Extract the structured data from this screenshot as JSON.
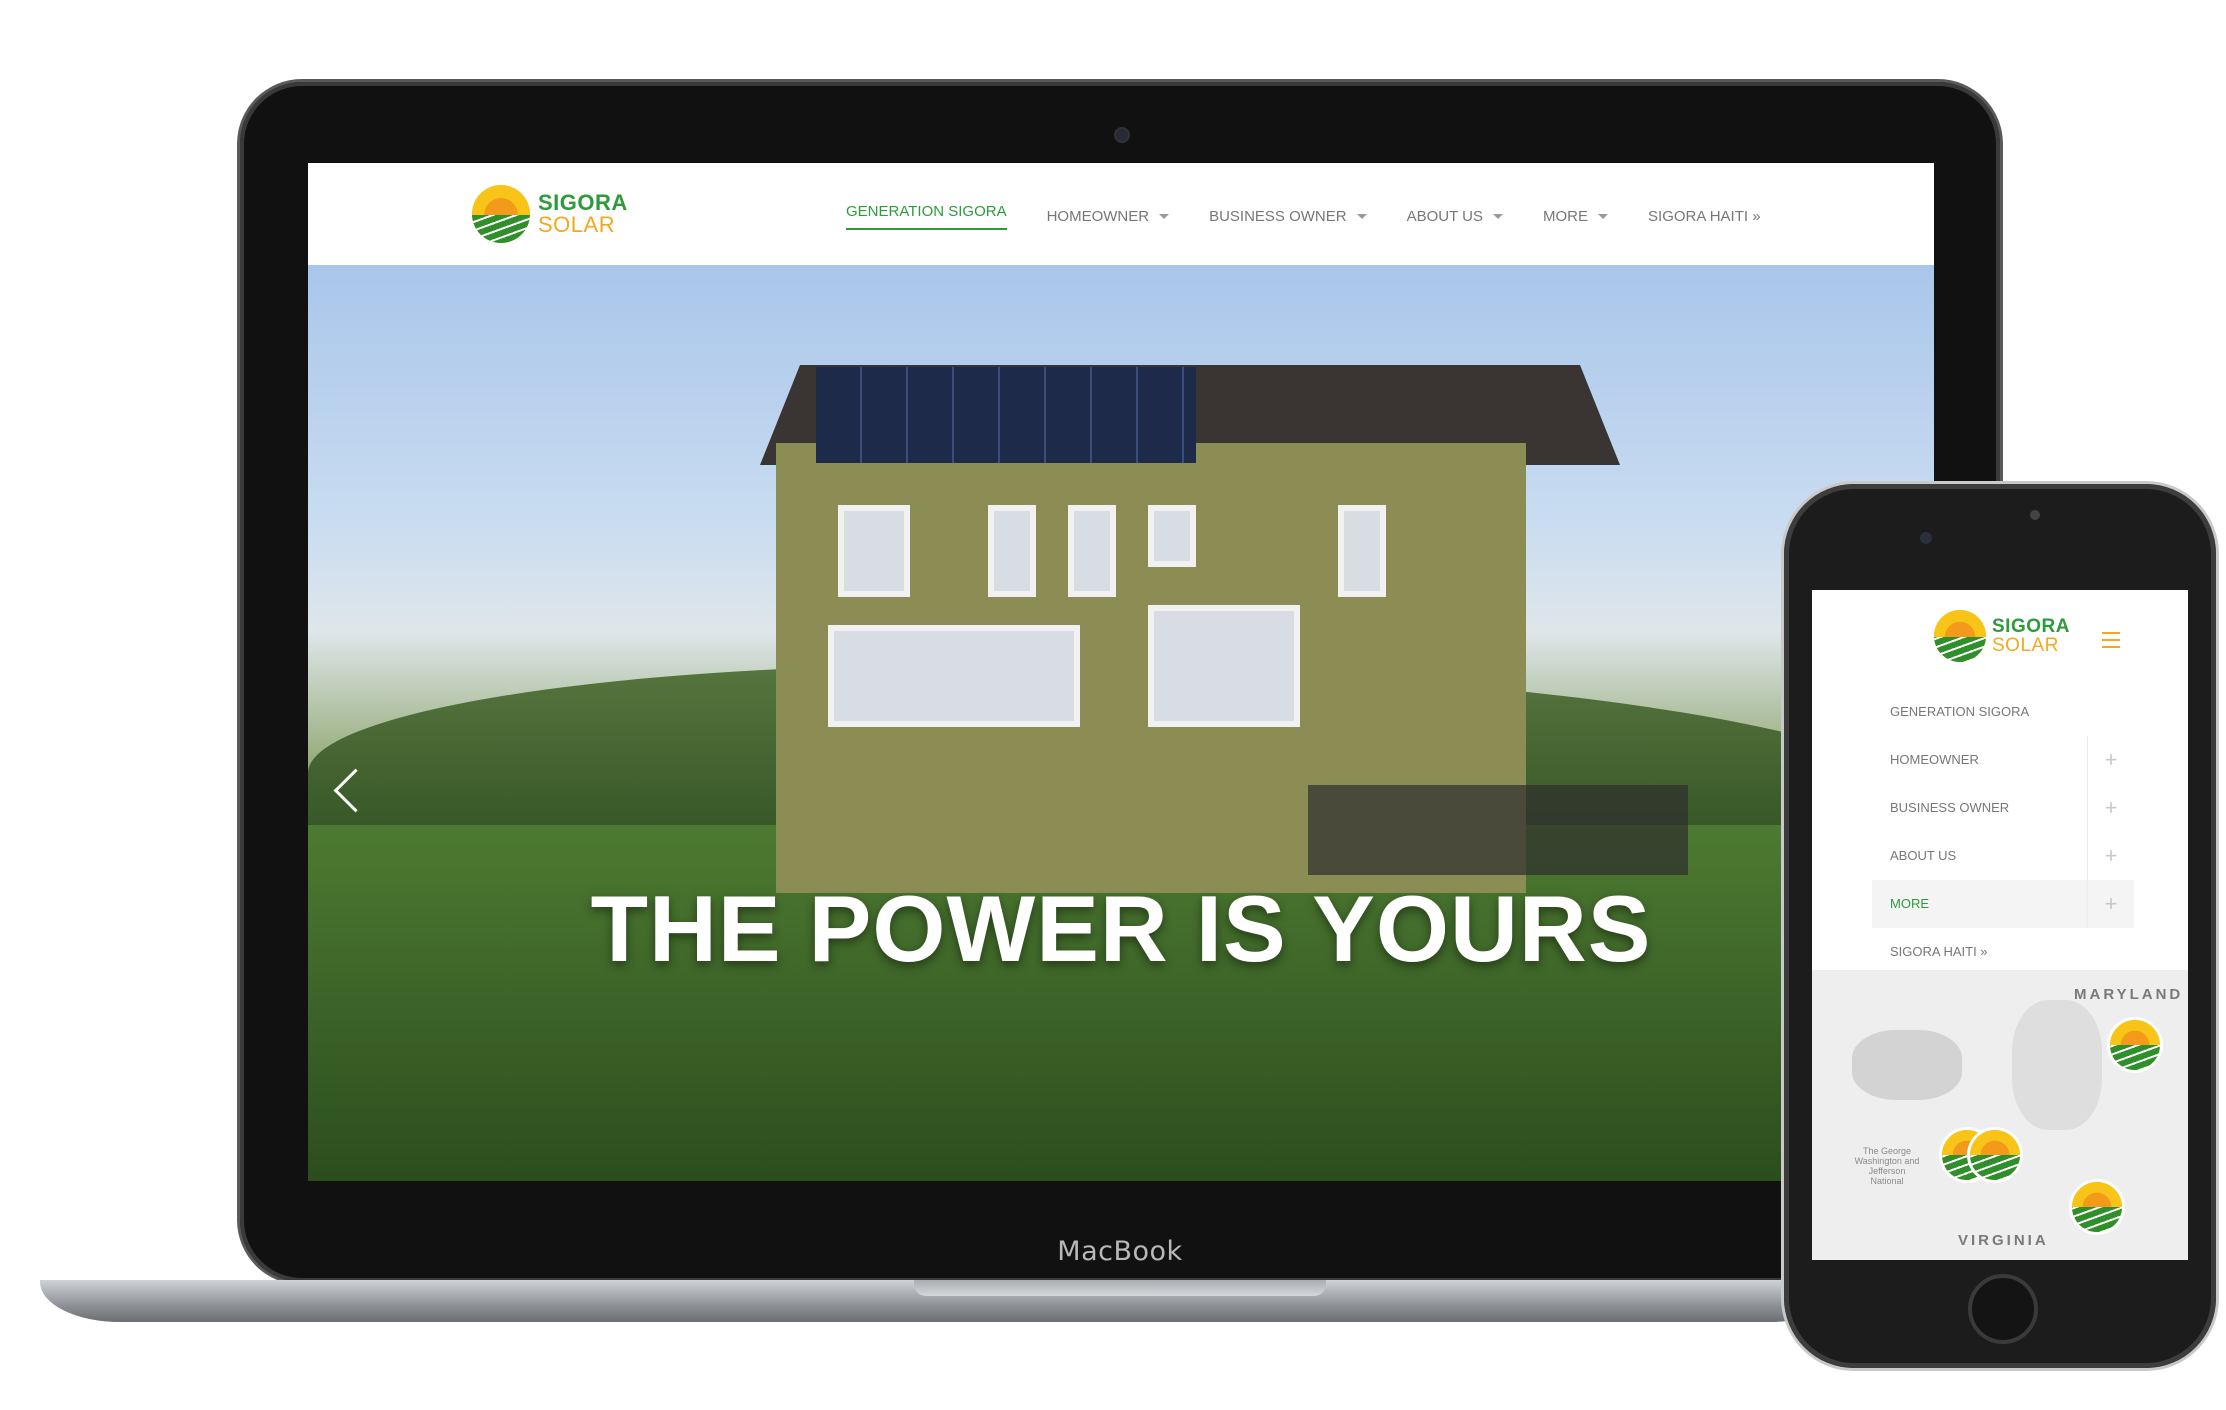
{
  "site": {
    "logo": {
      "line1": "SIGORA",
      "line2": "SOLAR"
    },
    "nav": [
      {
        "label": "GENERATION SIGORA",
        "dropdown": false,
        "active": true
      },
      {
        "label": "HOMEOWNER",
        "dropdown": true
      },
      {
        "label": "BUSINESS OWNER",
        "dropdown": true
      },
      {
        "label": "ABOUT US",
        "dropdown": true
      },
      {
        "label": "MORE",
        "dropdown": true
      },
      {
        "label": "SIGORA HAITI »",
        "dropdown": false
      }
    ],
    "hero_title": "THE POWER IS YOURS"
  },
  "device": {
    "laptop_brand": "MacBook"
  },
  "mobile": {
    "logo": {
      "line1": "SIGORA",
      "line2": "SOLAR"
    },
    "menu": [
      {
        "label": "GENERATION SIGORA",
        "expandable": false
      },
      {
        "label": "HOMEOWNER",
        "expandable": true
      },
      {
        "label": "BUSINESS OWNER",
        "expandable": true
      },
      {
        "label": "ABOUT US",
        "expandable": true
      },
      {
        "label": "MORE",
        "expandable": true,
        "active": true
      },
      {
        "label": "SIGORA HAITI »",
        "expandable": false
      }
    ],
    "plus_symbol": "+",
    "map": {
      "label_top": "MARYLAND",
      "label_bottom": "VIRGINIA",
      "park_label": "The George Washington and Jefferson National"
    }
  },
  "colors": {
    "brand_green": "#2a9c3b",
    "brand_orange": "#f3a91d"
  }
}
